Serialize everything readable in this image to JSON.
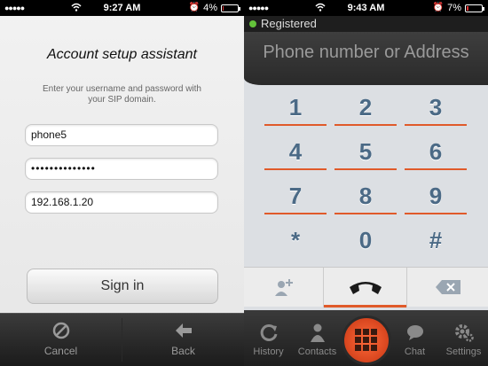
{
  "left_screen": {
    "status": {
      "time": "9:27 AM",
      "battery": "4%"
    },
    "title": "Account setup assistant",
    "description": "Enter your username and password with your SIP domain.",
    "username": "phone5",
    "password": "••••••••••••••",
    "domain": "192.168.1.20",
    "sign_in_label": "Sign in",
    "cancel_label": "Cancel",
    "back_label": "Back"
  },
  "right_screen": {
    "status": {
      "time": "9:43 AM",
      "battery": "7%"
    },
    "registration": "Registered",
    "address_placeholder": "Phone number or Address",
    "keys": [
      "1",
      "2",
      "3",
      "4",
      "5",
      "6",
      "7",
      "8",
      "9",
      "*",
      "0",
      "#"
    ],
    "tabs": {
      "history": "History",
      "contacts": "Contacts",
      "chat": "Chat",
      "settings": "Settings"
    }
  },
  "colors": {
    "accent": "#e05a2a",
    "digit": "#4b6a86",
    "registered": "#63c23a"
  },
  "icons": [
    "wifi-icon",
    "alarm-icon",
    "battery-icon",
    "cancel-icon",
    "back-arrow-icon",
    "add-contact-icon",
    "phone-handset-icon",
    "backspace-icon",
    "history-icon",
    "contacts-icon",
    "dialpad-icon",
    "chat-icon",
    "settings-icon"
  ]
}
